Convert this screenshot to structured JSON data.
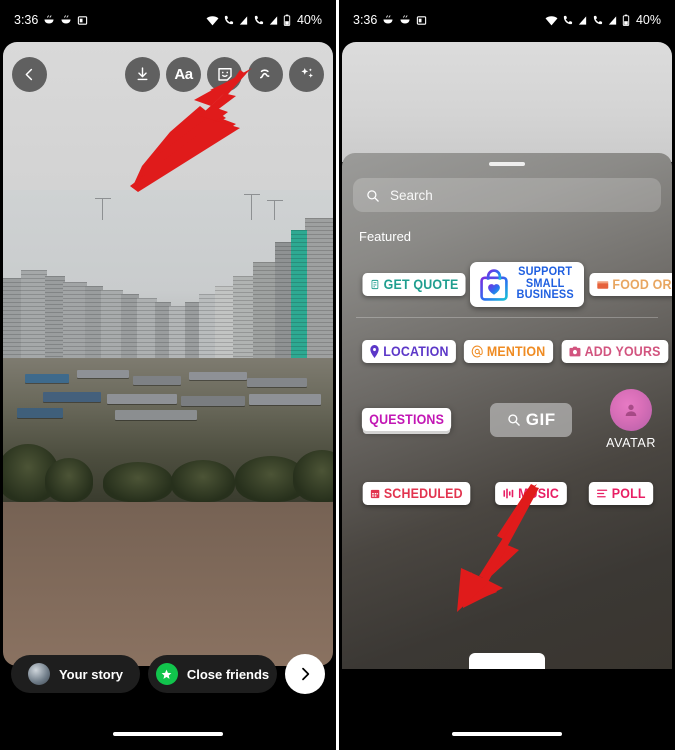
{
  "status_bar": {
    "time": "3:36",
    "battery_percent": "40%",
    "left_icons": [
      "bowl-icon",
      "bowl-icon",
      "screenshot-icon"
    ],
    "right_icons": [
      "wifi-icon",
      "call-sim1-icon",
      "signal-sim1-icon",
      "call-sim2-icon",
      "signal-sim2-icon",
      "battery-icon"
    ]
  },
  "left_phone": {
    "toolbar": {
      "back_label": "‹",
      "tools": [
        {
          "name": "save-icon",
          "label": "Save"
        },
        {
          "name": "text-icon",
          "label": "Aa"
        },
        {
          "name": "sticker-icon",
          "label": "Stickers"
        },
        {
          "name": "draw-icon",
          "label": "Draw"
        },
        {
          "name": "effects-icon",
          "label": "Effects"
        }
      ]
    },
    "share_bar": {
      "your_story": "Your story",
      "close_friends": "Close friends",
      "next_label": "›"
    }
  },
  "right_phone": {
    "tray": {
      "search_placeholder": "Search",
      "section_title": "Featured",
      "rows": [
        [
          {
            "name": "sticker-get-quote",
            "label": "GET QUOTE",
            "icon": "calculator-icon",
            "color": "#1f9e8f"
          },
          {
            "name": "sticker-support-small-business",
            "label": "SUPPORT SMALL BUSINESS",
            "icon": "shopping-bag-heart-icon",
            "color": "#1f5fe0"
          },
          {
            "name": "sticker-food-orders",
            "label": "FOOD ORDERS",
            "icon": "food-box-icon",
            "color": "#e8a661"
          }
        ],
        [
          {
            "name": "sticker-location",
            "label": "LOCATION",
            "icon": "pin-icon",
            "color": "#5c37c8"
          },
          {
            "name": "sticker-mention",
            "label": "MENTION",
            "icon": "at-icon",
            "color": "#ef8b22"
          },
          {
            "name": "sticker-add-yours",
            "label": "ADD YOURS",
            "icon": "camera-icon",
            "color": "#d2547f"
          }
        ],
        [
          {
            "name": "sticker-questions",
            "label": "QUESTIONS",
            "icon": "",
            "color": "#c216b4"
          },
          {
            "name": "sticker-gif",
            "label": "GIF",
            "icon": "search-icon",
            "color": "#ffffff"
          },
          {
            "name": "sticker-avatar",
            "label": "AVATAR",
            "icon": "avatar-icon",
            "color": "#ffffff"
          }
        ],
        [
          {
            "name": "sticker-scheduled",
            "label": "SCHEDULED",
            "icon": "calendar-icon",
            "color": "#e2344f"
          },
          {
            "name": "sticker-music",
            "label": "MUSIC",
            "icon": "equalizer-icon",
            "color": "#e81e63"
          },
          {
            "name": "sticker-poll",
            "label": "POLL",
            "icon": "bars-icon",
            "color": "#e81e63"
          }
        ]
      ]
    }
  },
  "annotations": [
    {
      "name": "arrow-to-sticker-tool",
      "color": "#e01b1b",
      "points_to": "sticker-icon"
    },
    {
      "name": "arrow-to-scheduled-sticker",
      "color": "#e01b1b",
      "points_to": "sticker-scheduled"
    }
  ]
}
